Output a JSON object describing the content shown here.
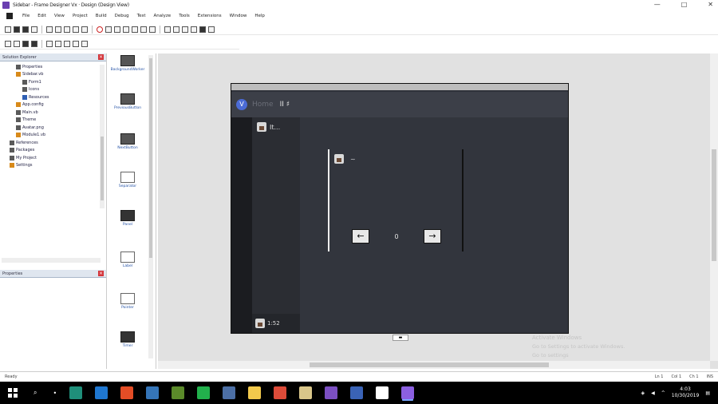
{
  "window": {
    "title": "Sidebar - Frame Designer Vx · Design (Design View)",
    "controls": [
      "—",
      "□",
      "✕"
    ]
  },
  "menubar": {
    "items": [
      "File",
      "Edit",
      "View",
      "Project",
      "Build",
      "Debug",
      "Test",
      "Analyze",
      "Tools",
      "Extensions",
      "Window",
      "Help"
    ]
  },
  "solution_tree": {
    "header": "Solution Explorer",
    "close": "×",
    "rows": [
      {
        "label": "Properties",
        "indent": 2
      },
      {
        "label": "Sidebar.vb",
        "indent": 2
      },
      {
        "label": "Form1",
        "indent": 3
      },
      {
        "label": "Icons",
        "indent": 3
      },
      {
        "label": "Resources",
        "indent": 3
      },
      {
        "label": "App.config",
        "indent": 2
      },
      {
        "label": "Main.vb",
        "indent": 2
      },
      {
        "label": "Theme",
        "indent": 2
      },
      {
        "label": "Avatar.png",
        "indent": 2
      },
      {
        "label": "Module1.vb",
        "indent": 2
      },
      {
        "label": "References",
        "indent": 1
      },
      {
        "label": "Packages",
        "indent": 1
      },
      {
        "label": "My Project",
        "indent": 1
      },
      {
        "label": "Settings",
        "indent": 1
      }
    ],
    "second_header": "Properties",
    "second_close": "×"
  },
  "palette": {
    "items": [
      {
        "label": "BackgroundWorker",
        "variant": "dark"
      },
      {
        "label": "PreviousButton",
        "variant": "dark"
      },
      {
        "label": "NextButton",
        "variant": "dark"
      },
      {
        "label": "Separator",
        "variant": "light"
      },
      {
        "label": "Panel",
        "variant": "dark2"
      },
      {
        "label": "Label",
        "variant": "light"
      },
      {
        "label": "Pointer",
        "variant": "light"
      },
      {
        "label": "Timer",
        "variant": "dark2"
      }
    ]
  },
  "designed_app": {
    "logo": "V",
    "name": "Home",
    "header_tag": "II ♯",
    "sidebar_item": "It...",
    "bottom_left": "1:52",
    "card_title": "~",
    "pager": {
      "prev": "←",
      "count": "0",
      "next": "→"
    }
  },
  "watermark": {
    "title": "Activate Windows",
    "line": "Go to Settings to activate Windows.",
    "line2": "Go to settings"
  },
  "statusbar": {
    "left": "Ready",
    "right": [
      "Ln 1",
      "Col 1",
      "Ch 1",
      "INS"
    ]
  },
  "taskbar": {
    "clock_time": "4:03",
    "clock_date": "10/30/2019"
  }
}
